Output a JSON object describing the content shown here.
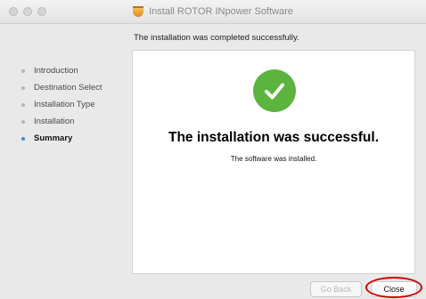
{
  "window": {
    "title": "Install ROTOR INpower Software"
  },
  "header": {
    "subtitle": "The installation was completed successfully."
  },
  "sidebar": {
    "steps": [
      {
        "label": "Introduction",
        "active": false
      },
      {
        "label": "Destination Select",
        "active": false
      },
      {
        "label": "Installation Type",
        "active": false
      },
      {
        "label": "Installation",
        "active": false
      },
      {
        "label": "Summary",
        "active": true
      }
    ]
  },
  "content": {
    "success_icon": "checkmark-circle-icon",
    "heading": "The installation was successful.",
    "message": "The software was installed."
  },
  "buttons": {
    "go_back": "Go Back",
    "close": "Close"
  },
  "colors": {
    "success_green": "#5cb33e",
    "active_step": "#3b8ee3",
    "highlight_ring": "#d00000"
  }
}
